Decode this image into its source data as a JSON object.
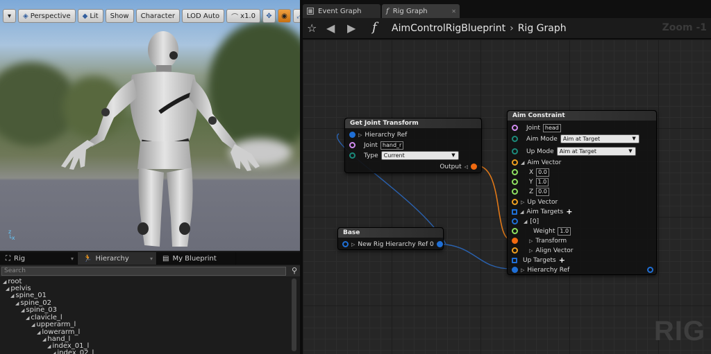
{
  "viewport": {
    "toolbar": {
      "perspective": "Perspective",
      "lit": "Lit",
      "show": "Show",
      "character": "Character",
      "lod": "LOD Auto",
      "speed": "x1.0"
    }
  },
  "left_panel": {
    "tabs": [
      "Rig",
      "Hierarchy",
      "My Blueprint"
    ],
    "search_placeholder": "Search",
    "tree": [
      "root",
      "pelvis",
      "spine_01",
      "spine_02",
      "spine_03",
      "clavicle_l",
      "upperarm_l",
      "lowerarm_l",
      "hand_l",
      "index_01_l",
      "index_02_l"
    ]
  },
  "editor": {
    "tabs": [
      "Event Graph",
      "Rig Graph"
    ],
    "breadcrumb": {
      "blueprint": "AimControlRigBlueprint",
      "graph": "Rig Graph"
    },
    "zoom": "Zoom -1",
    "watermark": "RIG"
  },
  "nodes": {
    "get_joint_transform": {
      "title": "Get Joint Transform",
      "hierarchy_ref": "Hierarchy Ref",
      "joint_label": "Joint",
      "joint_value": "hand_r",
      "type_label": "Type",
      "type_value": "Current",
      "output_label": "Output"
    },
    "base": {
      "title": "Base",
      "output_label": "New Rig Hierarchy Ref 0"
    },
    "aim_constraint": {
      "title": "Aim Constraint",
      "joint_label": "Joint",
      "joint_value": "head",
      "aim_mode_label": "Aim Mode",
      "aim_mode_value": "Aim at Target",
      "up_mode_label": "Up Mode",
      "up_mode_value": "Aim at Target",
      "aim_vector_label": "Aim Vector",
      "x_label": "X",
      "x_value": "0.0",
      "y_label": "Y",
      "y_value": "1.0",
      "z_label": "Z",
      "z_value": "0.0",
      "up_vector_label": "Up Vector",
      "aim_targets_label": "Aim Targets",
      "index_label": "[0]",
      "weight_label": "Weight",
      "weight_value": "1.0",
      "transform_label": "Transform",
      "align_vector_label": "Align Vector",
      "up_targets_label": "Up Targets",
      "hierarchy_ref_label": "Hierarchy Ref"
    }
  },
  "colors": {
    "pin_hierarchy": "#1f6fd6",
    "pin_name": "#d18cf0",
    "pin_enum": "#1b8a7a",
    "pin_struct": "#f0a020",
    "pin_float": "#8ee060",
    "pin_transform": "#f06a10",
    "wire_blue": "#2a62b0",
    "wire_orange": "#e07818"
  }
}
